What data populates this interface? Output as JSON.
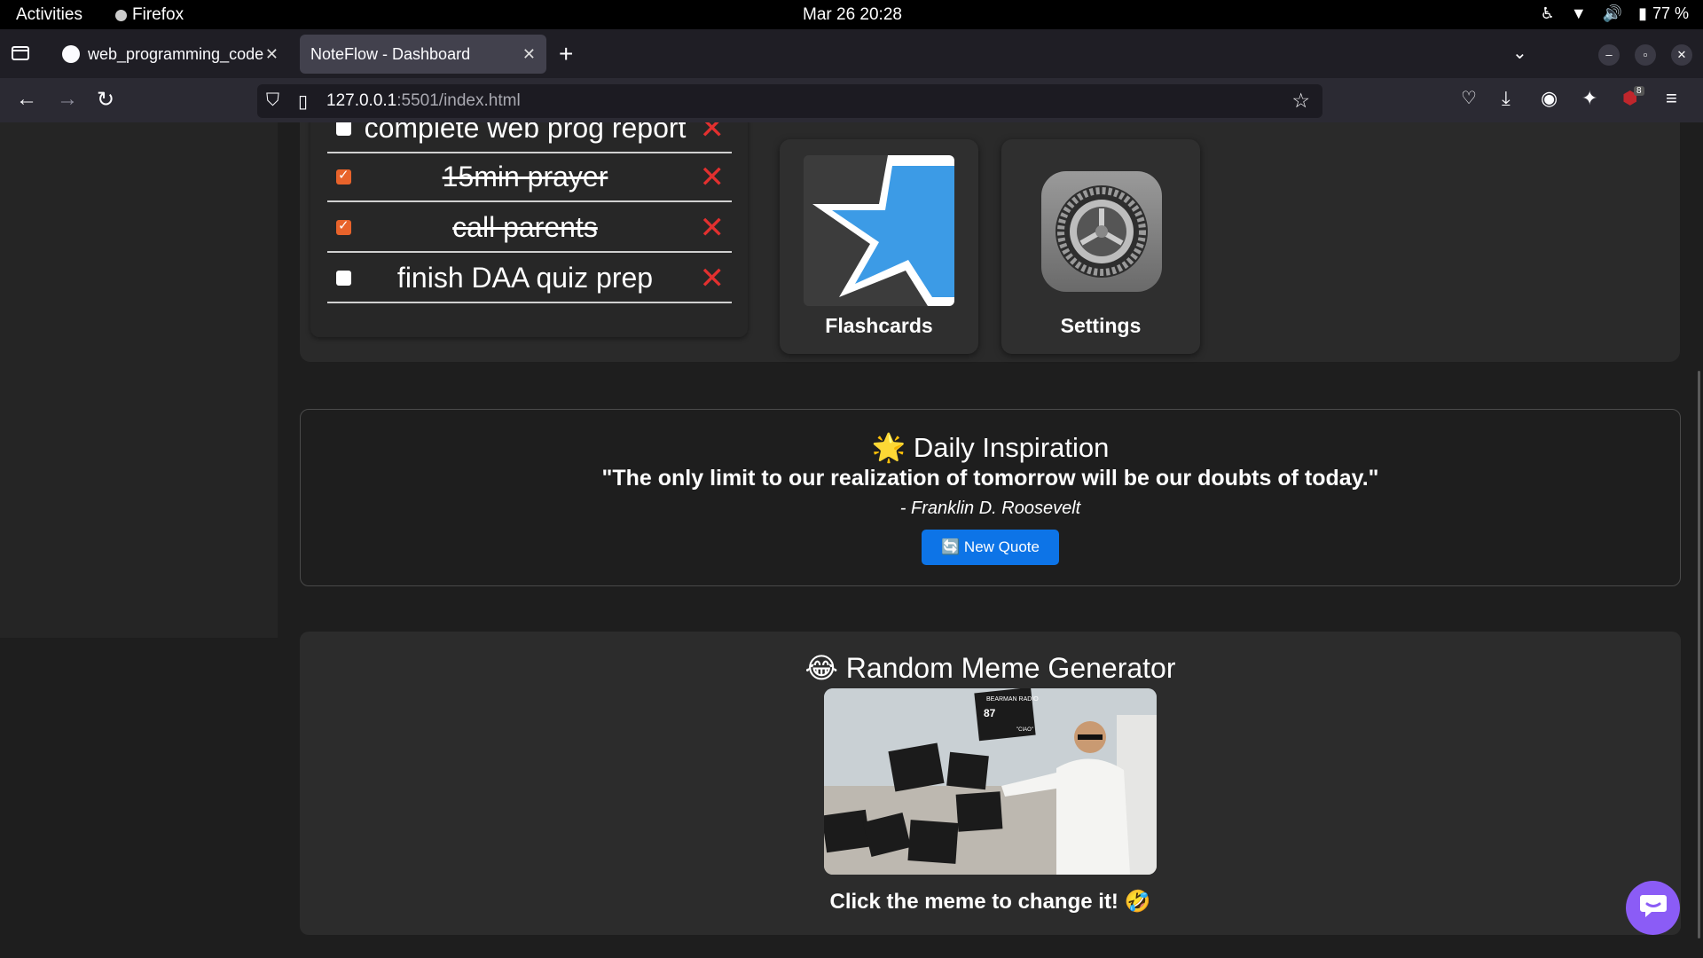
{
  "system": {
    "activities": "Activities",
    "app_name": "Firefox",
    "clock": "Mar 26  20:28",
    "battery": "77 %"
  },
  "browser": {
    "tabs": [
      {
        "title": "web_programming_code"
      },
      {
        "title": "NoteFlow - Dashboard"
      }
    ],
    "url_host": "127.0.0.1",
    "url_rest": ":5501/index.html",
    "extension_badge": "8"
  },
  "todo": {
    "items": [
      {
        "text": "complete web prog report",
        "done": false
      },
      {
        "text": "15min prayer",
        "done": true
      },
      {
        "text": "call parents",
        "done": true
      },
      {
        "text": "finish DAA quiz prep",
        "done": false
      }
    ]
  },
  "tiles": {
    "flashcards": "Flashcards",
    "settings": "Settings"
  },
  "inspiration": {
    "title": "🌟 Daily Inspiration",
    "quote": "\"The only limit to our realization of tomorrow will be our doubts of today.\"",
    "author": "- Franklin D. Roosevelt",
    "button": "🔄 New Quote"
  },
  "meme": {
    "title": "😂 Random Meme Generator",
    "hint": "Click the meme to change it! 🤣",
    "card_text": "BEARMAN RADIO",
    "card_number": "87",
    "card_tag": "\"CIAO\""
  },
  "colors": {
    "accent_check": "#e8632b",
    "delete_red": "#e2302f",
    "quote_button": "#0d74e7",
    "chat_fab": "#8b5cf6"
  }
}
